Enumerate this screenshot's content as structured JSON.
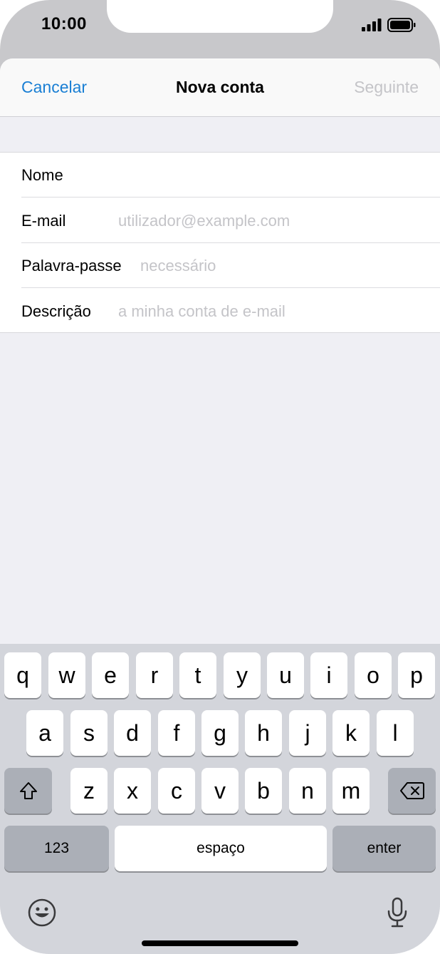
{
  "status_bar": {
    "time": "10:00"
  },
  "nav": {
    "cancel": "Cancelar",
    "title": "Nova conta",
    "next": "Seguinte"
  },
  "form": {
    "rows": [
      {
        "label": "Nome",
        "placeholder": ""
      },
      {
        "label": "E-mail",
        "placeholder": "utilizador@example.com"
      },
      {
        "label": "Palavra-passe",
        "placeholder": "necessário"
      },
      {
        "label": "Descrição",
        "placeholder": "a minha conta de e-mail"
      }
    ]
  },
  "keyboard": {
    "row1": [
      "q",
      "w",
      "e",
      "r",
      "t",
      "y",
      "u",
      "i",
      "o",
      "p"
    ],
    "row2": [
      "a",
      "s",
      "d",
      "f",
      "g",
      "h",
      "j",
      "k",
      "l"
    ],
    "row3": [
      "z",
      "x",
      "c",
      "v",
      "b",
      "n",
      "m"
    ],
    "numbers": "123",
    "space": "espaço",
    "enter": "enter"
  },
  "icons": {
    "signal": "signal-icon",
    "battery": "battery-icon",
    "shift": "shift-icon",
    "backspace": "backspace-icon",
    "emoji": "emoji-icon",
    "mic": "microphone-icon"
  },
  "colors": {
    "accent": "#1a7fd4",
    "disabled": "#c4c4c8",
    "keyboard_bg": "#d3d5db"
  }
}
